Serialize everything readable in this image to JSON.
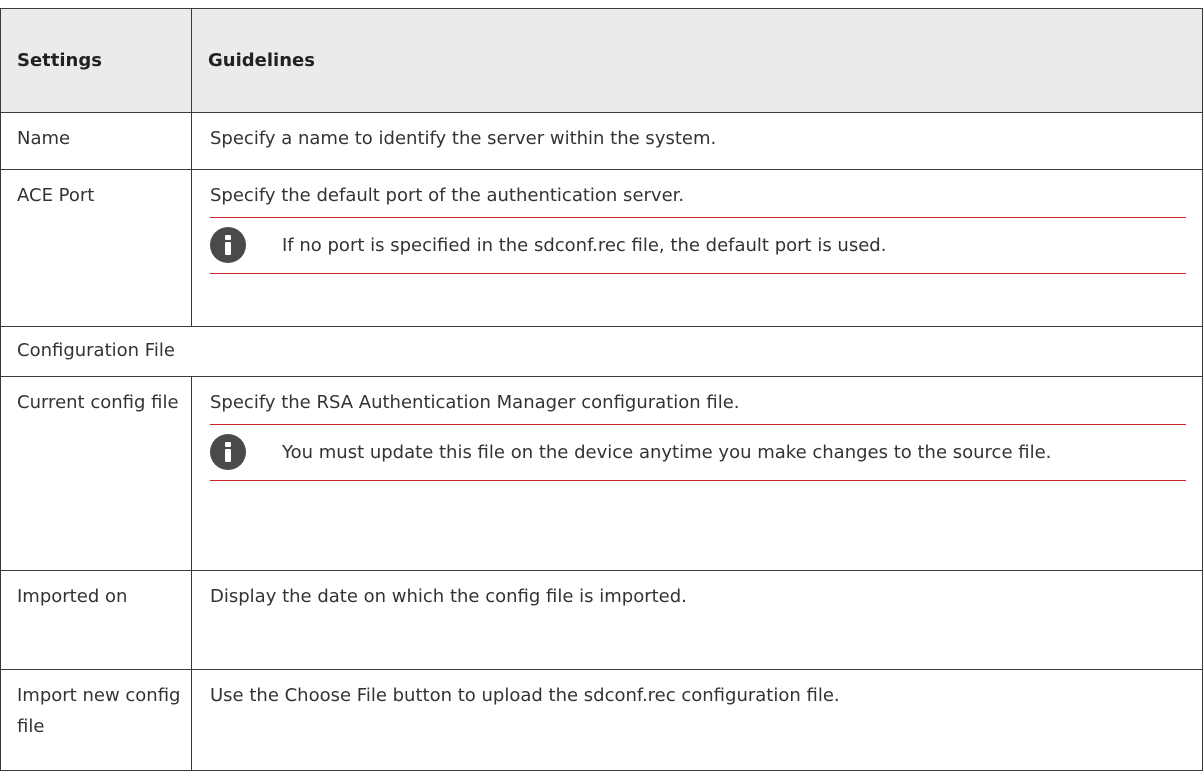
{
  "table": {
    "header": {
      "settings": "Settings",
      "guidelines": "Guidelines"
    },
    "rows": {
      "name": {
        "setting": "Name",
        "guideline": "Specify a name to identify the server within the system."
      },
      "ace_port": {
        "setting": "ACE Port",
        "guideline": "Specify the default port of the authentication server.",
        "note": "If no port is specified in the sdconf.rec file, the default port is used."
      },
      "section": "Configuration File",
      "current_config": {
        "setting": "Current config file",
        "guideline": "Specify the RSA Authentication Manager configuration file.",
        "note": "You must update this file on the device anytime you make changes to the source file."
      },
      "imported_on": {
        "setting": "Imported on",
        "guideline": "Display the date on which the config file is imported."
      },
      "import_new": {
        "setting": "Import new config file",
        "guideline": "Use the Choose File button to upload the sdconf.rec configuration file."
      }
    }
  },
  "icons": {
    "note_icon": "info-icon"
  },
  "colors": {
    "header_bg": "#ebebeb",
    "rule_red": "#c62828",
    "icon_bg": "#4a4a4a"
  }
}
